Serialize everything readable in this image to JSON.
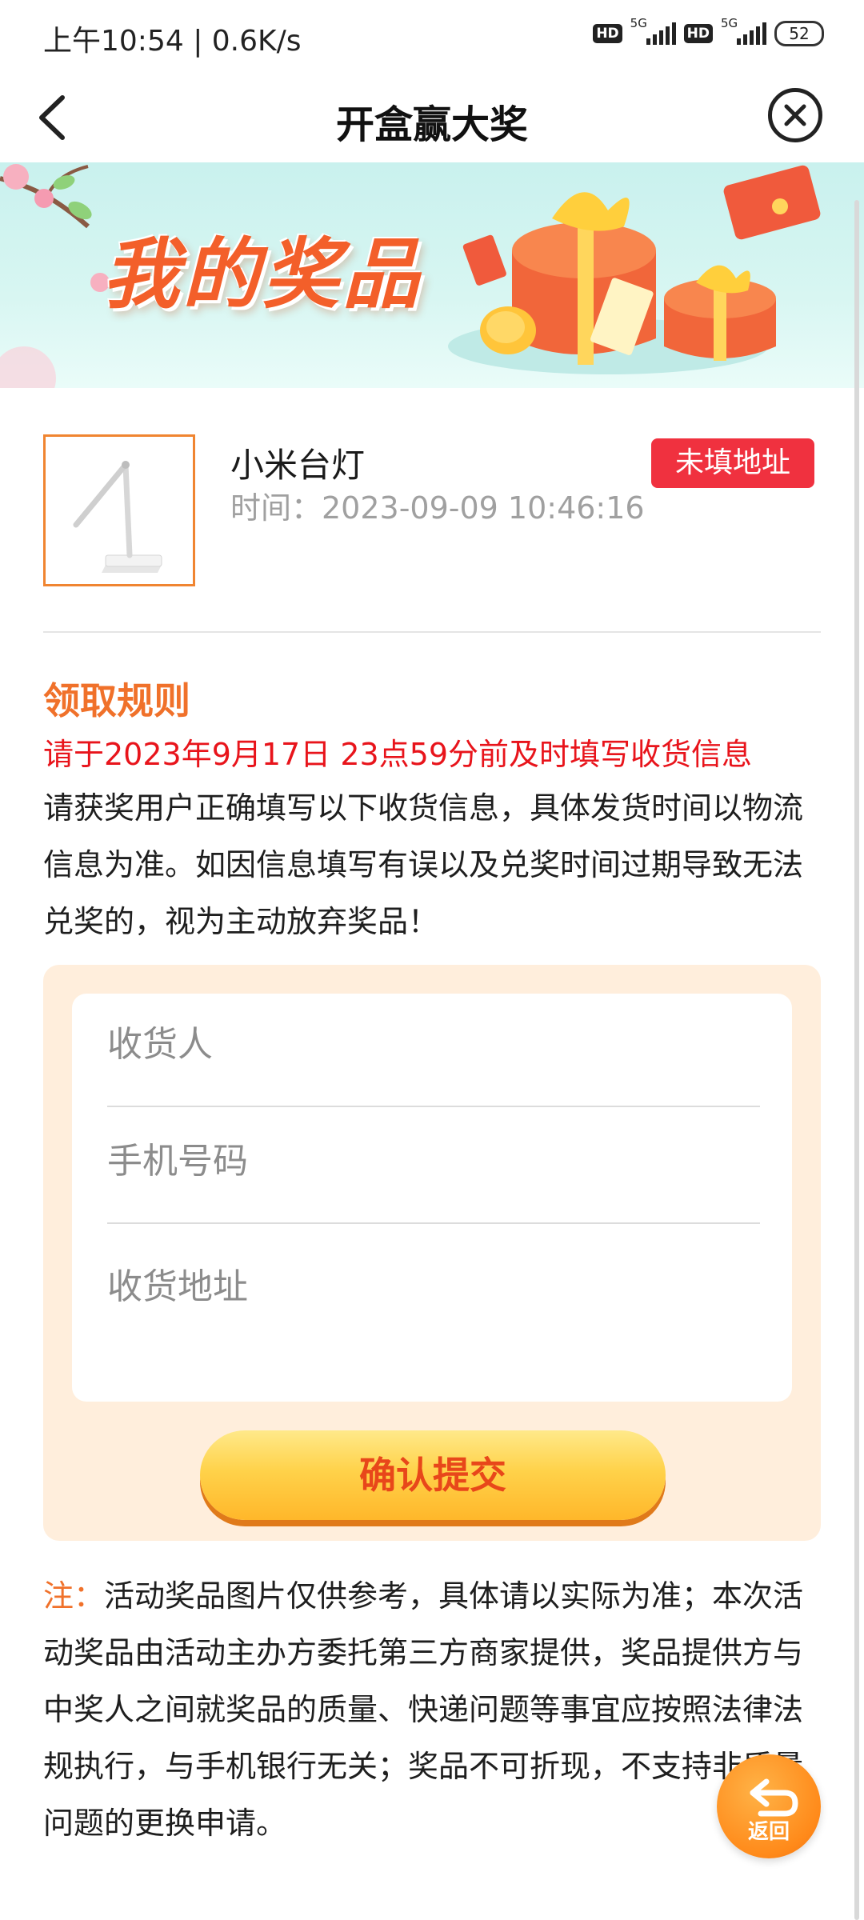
{
  "status_bar": {
    "time": "上午10:54 | 0.6K/s",
    "hd1": "HD",
    "net1": "5G",
    "hd2": "HD",
    "net2": "5G",
    "battery": "52"
  },
  "header": {
    "title": "开盒赢大奖",
    "back_icon": "chevron-left-icon",
    "close_icon": "close-circle-icon"
  },
  "banner": {
    "title": "我的奖品"
  },
  "prize": {
    "name": "小米台灯",
    "time": "时间：2023-09-09 10:46:16",
    "status_badge": "未填地址",
    "badge_color": "#f0313f"
  },
  "rules": {
    "title": "领取规则",
    "deadline": "请于2023年9月17日 23点59分前及时填写收货信息",
    "body": "请获奖用户正确填写以下收货信息，具体发货时间以物流信息为准。如因信息填写有误以及兑奖时间过期导致无法兑奖的，视为主动放弃奖品！"
  },
  "form": {
    "recipient_placeholder": "收货人",
    "recipient_value": "",
    "phone_placeholder": "手机号码",
    "phone_value": "",
    "address_placeholder": "收货地址",
    "address_value": "",
    "submit_label": "确认提交"
  },
  "note": {
    "lead": "注：",
    "text": "活动奖品图片仅供参考，具体请以实际为准；本次活动奖品由活动主办方委托第三方商家提供，奖品提供方与中奖人之间就奖品的质量、快递问题等事宜应按照法律法规执行，与手机银行无关；奖品不可折现，不支持非质量问题的更换申请。"
  },
  "fab": {
    "label": "返回",
    "icon": "return-arrow-icon"
  },
  "colors": {
    "accent_orange": "#f0712a",
    "deadline_red": "#e8141b",
    "form_bg": "#ffeedc"
  }
}
